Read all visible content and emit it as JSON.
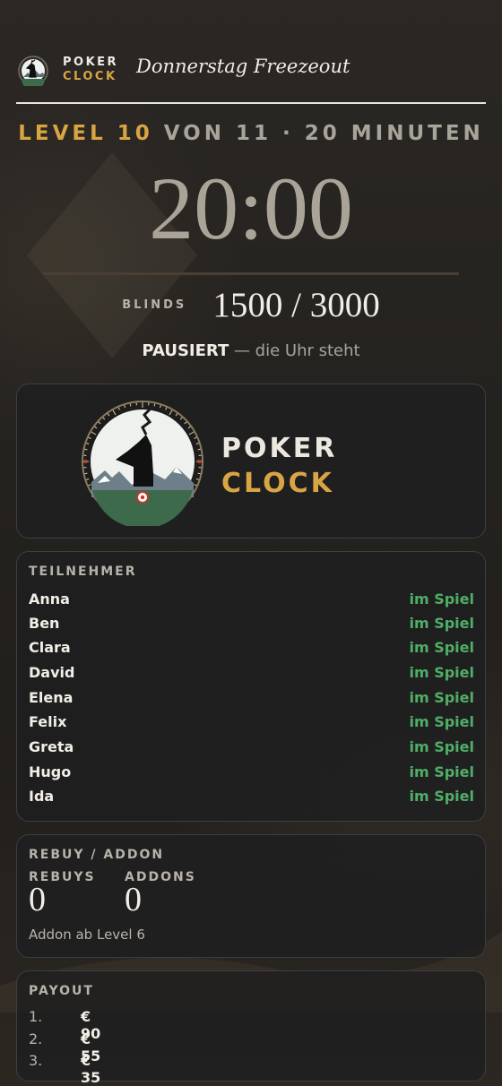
{
  "header": {
    "logo_line1": "POKER",
    "logo_line2": "CLOCK",
    "title": "Donnerstag Freezeout"
  },
  "clock": {
    "level_label": "LEVEL 10",
    "level_rest": "VON 11 · 20 MINUTEN",
    "time": "20:00",
    "blinds_label": "BLINDS",
    "blinds_value": "1500 / 3000",
    "status_bold": "PAUSIERT",
    "status_rest": " — die Uhr steht"
  },
  "brand_card": {
    "line1": "POKER",
    "line2": "CLOCK"
  },
  "players": {
    "title": "TEILNEHMER",
    "rows": [
      {
        "name": "Anna",
        "status": "im Spiel"
      },
      {
        "name": "Ben",
        "status": "im Spiel"
      },
      {
        "name": "Clara",
        "status": "im Spiel"
      },
      {
        "name": "David",
        "status": "im Spiel"
      },
      {
        "name": "Elena",
        "status": "im Spiel"
      },
      {
        "name": "Felix",
        "status": "im Spiel"
      },
      {
        "name": "Greta",
        "status": "im Spiel"
      },
      {
        "name": "Hugo",
        "status": "im Spiel"
      },
      {
        "name": "Ida",
        "status": "im Spiel"
      }
    ]
  },
  "rebuy": {
    "title": "REBUY / ADDON",
    "rebuys_label": "REBUYS",
    "rebuys_value": "0",
    "addons_label": "ADDONS",
    "addons_value": "0",
    "note": "Addon ab Level 6"
  },
  "payout": {
    "title": "PAYOUT",
    "rows": [
      {
        "rank": "1.",
        "amount": "€ 90"
      },
      {
        "rank": "2.",
        "amount": "€ 55"
      },
      {
        "rank": "3.",
        "amount": "€ 35"
      }
    ]
  },
  "colors": {
    "accent": "#d9a443",
    "positive": "#4fae67",
    "background": "#25231f"
  },
  "icons": {
    "header_logo": "deer-clock-icon",
    "brand_logo": "deer-clock-dial-icon",
    "background": "diamond-suit-icon"
  }
}
